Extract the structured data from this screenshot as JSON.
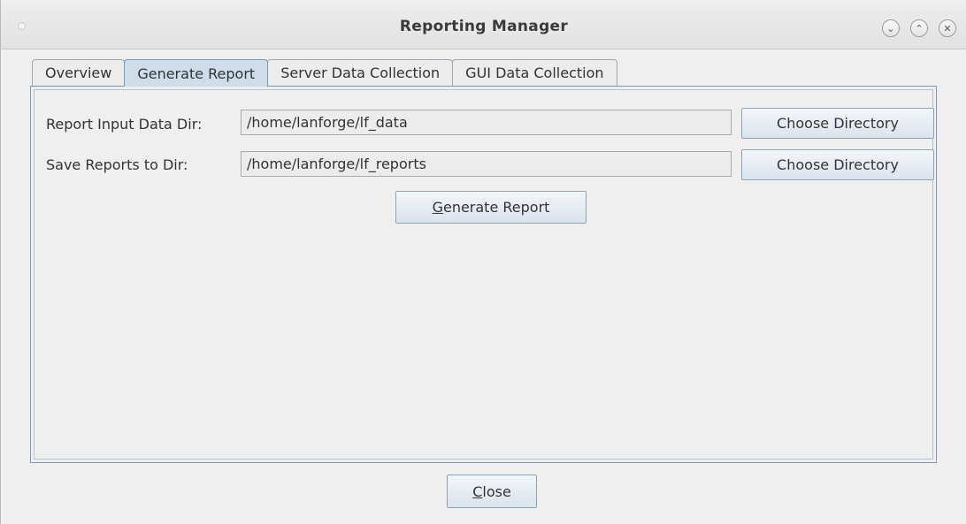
{
  "window": {
    "title": "Reporting Manager",
    "controls": {
      "minimize": "⌄",
      "maximize": "⌃",
      "close": "✕"
    }
  },
  "tabs": [
    {
      "label": "Overview",
      "active": false
    },
    {
      "label": "Generate Report",
      "active": true
    },
    {
      "label": "Server Data Collection",
      "active": false
    },
    {
      "label": "GUI Data Collection",
      "active": false
    }
  ],
  "form": {
    "input_dir": {
      "label": "Report Input Data Dir:",
      "value": "/home/lanforge/lf_data",
      "button": "Choose Directory"
    },
    "save_dir": {
      "label": "Save Reports to Dir:",
      "value": "/home/lanforge/lf_reports",
      "button": "Choose Directory"
    },
    "generate": {
      "mnemonic": "G",
      "rest": "enerate Report"
    }
  },
  "footer": {
    "close": {
      "mnemonic": "C",
      "rest": "lose"
    }
  }
}
